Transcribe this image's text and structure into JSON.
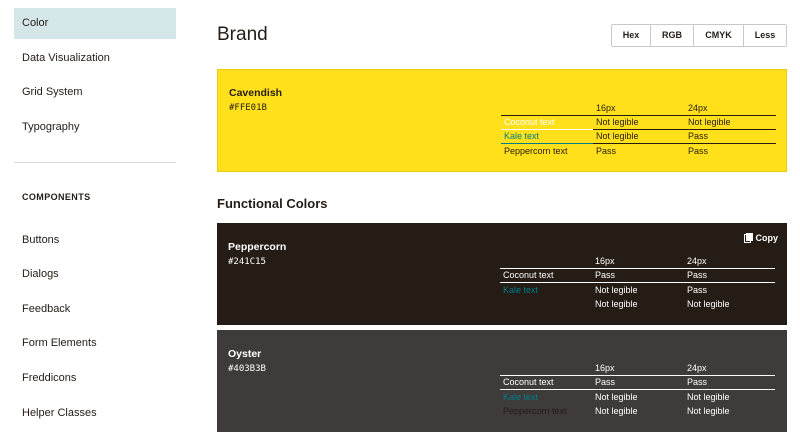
{
  "sidebar": {
    "items": [
      {
        "label": "Color",
        "active": true
      },
      {
        "label": "Data Visualization"
      },
      {
        "label": "Grid System"
      },
      {
        "label": "Typography"
      }
    ],
    "components_heading": "COMPONENTS",
    "components": [
      {
        "label": "Buttons"
      },
      {
        "label": "Dialogs"
      },
      {
        "label": "Feedback"
      },
      {
        "label": "Form Elements"
      },
      {
        "label": "Freddicons"
      },
      {
        "label": "Helper Classes"
      }
    ]
  },
  "main": {
    "title": "Brand",
    "format_toggle": [
      "Hex",
      "RGB",
      "CMYK",
      "Less"
    ],
    "functional_title": "Functional Colors"
  },
  "swatches": [
    {
      "name": "Cavendish",
      "hex": "#FFE01B",
      "bg_color": "#FFE01B",
      "header": [
        "",
        "16px",
        "24px"
      ],
      "rows": [
        [
          "Coconut text",
          "Not legible",
          "Not legible"
        ],
        [
          "Kale text",
          "Not legible",
          "Pass"
        ],
        [
          "Peppercorn text",
          "Pass",
          "Pass"
        ]
      ]
    },
    {
      "name": "Peppercorn",
      "hex": "#241C15",
      "bg_color": "#241C15",
      "copy_label": "Copy",
      "header": [
        "",
        "16px",
        "24px"
      ],
      "rows": [
        [
          "Coconut text",
          "Pass",
          "Pass"
        ],
        [
          "Kale text",
          "Not legible",
          "Pass"
        ],
        [
          "",
          "Not legible",
          "Not legible"
        ]
      ]
    },
    {
      "name": "Oyster",
      "hex": "#403B3B",
      "bg_color": "#403B3B",
      "header": [
        "",
        "16px",
        "24px"
      ],
      "rows": [
        [
          "Coconut text",
          "Pass",
          "Pass"
        ],
        [
          "Kale text",
          "Not legible",
          "Not legible"
        ],
        [
          "Peppercorn text",
          "Not legible",
          "Not legible"
        ]
      ]
    }
  ],
  "colors": {
    "sidebar_active_bg": "#D5E6E8",
    "coconut": "#FFFFFF",
    "kale": "#007C89",
    "peppercorn": "#241C15"
  },
  "icons": {
    "copy": "clipboard-icon"
  }
}
